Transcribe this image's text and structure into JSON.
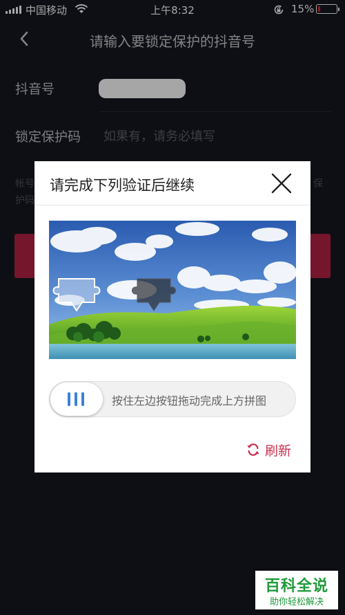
{
  "status_bar": {
    "carrier": "中国移动",
    "time": "上午8:32",
    "battery_percent": "15%",
    "battery_level": 0.15
  },
  "nav": {
    "title": "请输入要锁定保护的抖音号"
  },
  "form": {
    "account_label": "抖音号",
    "lock_code_label": "锁定保护码",
    "lock_code_placeholder": "如果有，请务必填写",
    "note_text": "帐号",
    "note_text_2": "护码",
    "note_text_right": "保"
  },
  "modal": {
    "title": "请完成下列验证后继续",
    "slider_hint": "按住左边按钮拖动完成上方拼图",
    "refresh_label": "刷新"
  },
  "watermark": {
    "line1": "百科全说",
    "line2": "助你轻松解决"
  },
  "colors": {
    "background": "#16171f",
    "accent": "#b42244",
    "refresh": "#c9314f",
    "grip": "#3a82d6"
  }
}
